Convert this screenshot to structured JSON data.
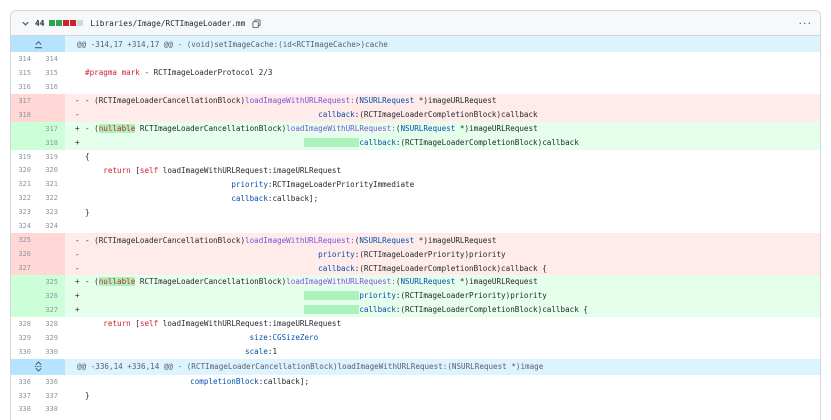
{
  "file": {
    "additions_count": "44",
    "diffstat_colors": [
      "#2da44e",
      "#2da44e",
      "#cf222e",
      "#cf222e",
      "#d0d7de"
    ],
    "path": "Libraries/Image/RCTImageLoader.mm",
    "more_label": "···"
  },
  "hunks": {
    "top": "@@ -314,17 +314,17 @@ - (void)setImageCache:(id<RCTImageCache>)cache",
    "bottom": "@@ -336,14 +336,14 @@ - (RCTImageLoaderCancellationBlock)loadImageWithURLRequest:(NSURLRequest *)image"
  },
  "lines": [
    {
      "type": "ctx",
      "old": "314",
      "new": "314",
      "marker": " ",
      "text": ""
    },
    {
      "type": "ctx",
      "old": "315",
      "new": "315",
      "marker": " ",
      "text": "#pragma mark - RCTImageLoaderProtocol 2/3"
    },
    {
      "type": "ctx",
      "old": "316",
      "new": "316",
      "marker": " ",
      "text": ""
    },
    {
      "type": "del",
      "old": "317",
      "new": "",
      "marker": "-",
      "text": "- (RCTImageLoaderCancellationBlock)loadImageWithURLRequest:(NSURLRequest *)imageURLRequest"
    },
    {
      "type": "del",
      "old": "318",
      "new": "",
      "marker": "-",
      "text": "                                                   callback:(RCTImageLoaderCompletionBlock)callback"
    },
    {
      "type": "add",
      "old": "",
      "new": "317",
      "marker": "+",
      "text": "- (nullable RCTImageLoaderCancellationBlock)loadImageWithURLRequest:(NSURLRequest *)imageURLRequest"
    },
    {
      "type": "add",
      "old": "",
      "new": "318",
      "marker": "+",
      "text": "                                                            callback:(RCTImageLoaderCompletionBlock)callback"
    },
    {
      "type": "ctx",
      "old": "319",
      "new": "319",
      "marker": " ",
      "text": "{"
    },
    {
      "type": "ctx",
      "old": "320",
      "new": "320",
      "marker": " ",
      "text": "    return [self loadImageWithURLRequest:imageURLRequest"
    },
    {
      "type": "ctx",
      "old": "321",
      "new": "321",
      "marker": " ",
      "text": "                                priority:RCTImageLoaderPriorityImmediate"
    },
    {
      "type": "ctx",
      "old": "322",
      "new": "322",
      "marker": " ",
      "text": "                                callback:callback];"
    },
    {
      "type": "ctx",
      "old": "323",
      "new": "323",
      "marker": " ",
      "text": "}"
    },
    {
      "type": "ctx",
      "old": "324",
      "new": "324",
      "marker": " ",
      "text": ""
    },
    {
      "type": "del",
      "old": "325",
      "new": "",
      "marker": "-",
      "text": "- (RCTImageLoaderCancellationBlock)loadImageWithURLRequest:(NSURLRequest *)imageURLRequest"
    },
    {
      "type": "del",
      "old": "326",
      "new": "",
      "marker": "-",
      "text": "                                                   priority:(RCTImageLoaderPriority)priority"
    },
    {
      "type": "del",
      "old": "327",
      "new": "",
      "marker": "-",
      "text": "                                                   callback:(RCTImageLoaderCompletionBlock)callback {"
    },
    {
      "type": "add",
      "old": "",
      "new": "325",
      "marker": "+",
      "text": "- (nullable RCTImageLoaderCancellationBlock)loadImageWithURLRequest:(NSURLRequest *)imageURLRequest"
    },
    {
      "type": "add",
      "old": "",
      "new": "326",
      "marker": "+",
      "text": "                                                            priority:(RCTImageLoaderPriority)priority"
    },
    {
      "type": "add",
      "old": "",
      "new": "327",
      "marker": "+",
      "text": "                                                            callback:(RCTImageLoaderCompletionBlock)callback {"
    },
    {
      "type": "ctx",
      "old": "328",
      "new": "328",
      "marker": " ",
      "text": "    return [self loadImageWithURLRequest:imageURLRequest"
    },
    {
      "type": "ctx",
      "old": "329",
      "new": "329",
      "marker": " ",
      "text": "                                    size:CGSizeZero"
    },
    {
      "type": "ctx",
      "old": "330",
      "new": "330",
      "marker": " ",
      "text": "                                   scale:1"
    }
  ],
  "lines_after": [
    {
      "type": "ctx",
      "old": "336",
      "new": "336",
      "marker": " ",
      "text": "                       completionBlock:callback];"
    },
    {
      "type": "ctx",
      "old": "337",
      "new": "337",
      "marker": " ",
      "text": "}"
    },
    {
      "type": "ctx",
      "old": "338",
      "new": "338",
      "marker": " ",
      "text": ""
    }
  ]
}
